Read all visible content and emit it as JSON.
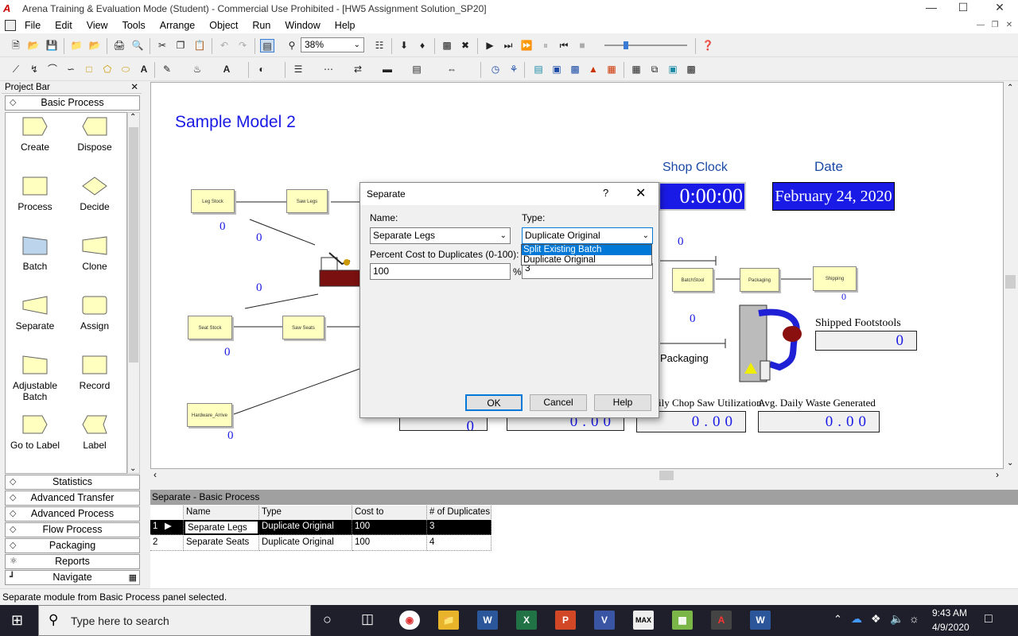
{
  "window": {
    "title": "Arena Training & Evaluation Mode (Student) - Commercial Use Prohibited - [HW5 Assignment Solution_SP20]",
    "app_icon": "arena-icon",
    "controls": [
      "minimize-icon",
      "maximize-icon",
      "close-icon"
    ]
  },
  "menu": [
    "File",
    "Edit",
    "View",
    "Tools",
    "Arrange",
    "Object",
    "Run",
    "Window",
    "Help"
  ],
  "toolbar": {
    "zoom": "38%"
  },
  "project_bar": {
    "title": "Project Bar",
    "panel_open": "Basic Process",
    "modules": [
      {
        "label": "Create",
        "icon": "create-shape-icon"
      },
      {
        "label": "Dispose",
        "icon": "dispose-shape-icon"
      },
      {
        "label": "Process",
        "icon": "process-shape-icon"
      },
      {
        "label": "Decide",
        "icon": "decide-shape-icon"
      },
      {
        "label": "Batch",
        "icon": "batch-shape-icon"
      },
      {
        "label": "Clone",
        "icon": "clone-shape-icon"
      },
      {
        "label": "Separate",
        "icon": "separate-shape-icon"
      },
      {
        "label": "Assign",
        "icon": "assign-shape-icon"
      },
      {
        "label": "Adjustable Batch",
        "icon": "adjustable-batch-shape-icon"
      },
      {
        "label": "Record",
        "icon": "record-shape-icon"
      },
      {
        "label": "Go to Label",
        "icon": "goto-label-shape-icon"
      },
      {
        "label": "Label",
        "icon": "label-shape-icon"
      }
    ],
    "panels": [
      "Statistics",
      "Advanced Transfer",
      "Advanced Process",
      "Flow Process",
      "Packaging",
      "Reports",
      "Navigate"
    ]
  },
  "canvas": {
    "model_title": "Sample Model 2",
    "shop_clock_label": "Shop Clock",
    "shop_clock_value": "0:00:00",
    "date_label": "Date",
    "date_value": "February 24, 2020",
    "blocks": {
      "leg_stock": "Leg Stock",
      "saw_legs": "Saw Legs",
      "seat_stock": "Seat Stock",
      "saw_seats": "Saw Seats",
      "hardware_arrive": "Hardware_Arrive",
      "batch_stool": "BatchStool",
      "packaging": "Packaging",
      "shipping": "Shipping"
    },
    "counters": {
      "leg_stock": "0",
      "leg_queue": "0",
      "seat_queue": "0",
      "seat_stock": "0",
      "hardware": "0",
      "batch_queue": "0",
      "packaging_queue": "0",
      "shipping": "0"
    },
    "packaging_label": "Packaging",
    "shipped_label": "Shipped Footstools",
    "shipped_value": "0",
    "chop_label": "ily Chop Saw Utilization",
    "chop_value": "0.00",
    "waste_label": "Avg. Daily Waste Generated",
    "waste_value": "0.00",
    "left_box_value": "0",
    "mid_box_value": "0.00"
  },
  "dialog": {
    "title": "Separate",
    "help_glyph": "?",
    "name_label": "Name:",
    "name_value": "Separate Legs",
    "type_label": "Type:",
    "type_value": "Duplicate Original",
    "type_options": [
      "Split Existing Batch",
      "Duplicate Original"
    ],
    "type_highlighted": "Split Existing Batch",
    "percent_label": "Percent Cost to Duplicates (0-100):",
    "percent_value": "100",
    "percent_unit": "%",
    "duplicates_value": "3",
    "ok": "OK",
    "cancel": "Cancel",
    "help": "Help"
  },
  "sheet": {
    "title": "Separate - Basic Process",
    "columns": [
      "Name",
      "Type",
      "Cost to Duplicates",
      "# of Duplicates"
    ],
    "rows": [
      {
        "num": "1",
        "name": "Separate Legs",
        "type": "Duplicate Original",
        "cost": "100",
        "dups": "3"
      },
      {
        "num": "2",
        "name": "Separate Seats",
        "type": "Duplicate Original",
        "cost": "100",
        "dups": "4"
      }
    ]
  },
  "status": "Separate module from Basic Process panel selected.",
  "taskbar": {
    "search_placeholder": "Type here to search",
    "time": "9:43 AM",
    "date": "4/9/2020"
  }
}
